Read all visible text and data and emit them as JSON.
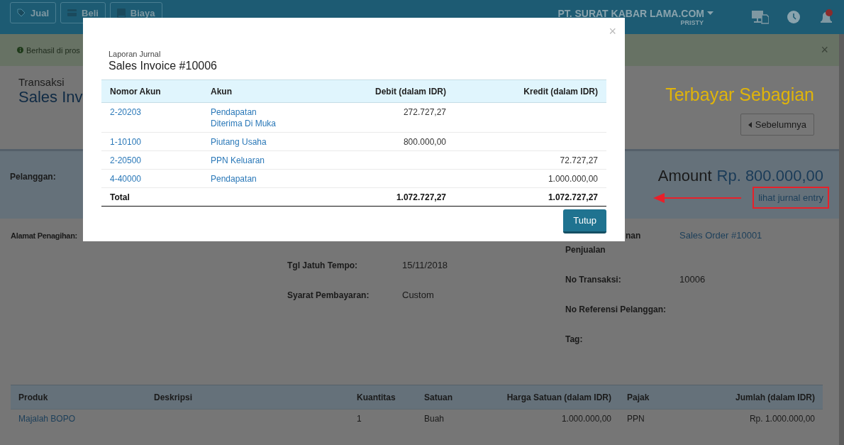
{
  "header": {
    "actions": [
      {
        "label": "Jual",
        "kind": "tag"
      },
      {
        "label": "Beli",
        "kind": "card"
      },
      {
        "label": "Biaya",
        "kind": "note"
      }
    ],
    "company": "PT. SURAT KABAR LAMA.COM",
    "user": "PRISTY",
    "notification_badge": true
  },
  "alert": {
    "text": "Berhasil di pros",
    "close": "×"
  },
  "page": {
    "subtitle": "Transaksi",
    "title": "Sales Inv",
    "status": "Terbayar Sebagian",
    "prev_button": "Sebelumnya"
  },
  "summary": {
    "customer_label": "Pelanggan:",
    "amount_label": "Amount",
    "amount_value": "Rp. 800.000,00",
    "journal_link": "lihat jurnal entry"
  },
  "details": [
    [
      {
        "label": "Alamat Penagihan:"
      }
    ],
    [
      {
        "label": "Tgl Jatuh Tempo:",
        "value": "15/11/2018"
      },
      {
        "label": "Syarat Pembayaran:",
        "value": "Custom"
      }
    ],
    [
      {
        "label": "nan Penjualan",
        "value": "Sales Order #10001",
        "kind": "link"
      },
      {
        "label": "No Transaksi:",
        "value": "10006",
        "kind": "text"
      },
      {
        "label": "No Referensi Pelanggan:"
      },
      {
        "label": "Tag:"
      }
    ]
  ],
  "products": {
    "columns": [
      "Produk",
      "Deskripsi",
      "Kuantitas",
      "Satuan",
      "Harga Satuan (dalam IDR)",
      "Pajak",
      "Jumlah (dalam IDR)"
    ],
    "rows": [
      {
        "product": "Majalah BOPO",
        "quantity": "1",
        "unit": "Buah",
        "price": "1.000.000,00",
        "tax": "PPN",
        "amount": "Rp. 1.000.000,00"
      }
    ]
  },
  "modal": {
    "close": "×",
    "subtitle": "Laporan Jurnal",
    "title": "Sales Invoice #10006",
    "columns": [
      "Nomor Akun",
      "Akun",
      "Debit (dalam IDR)",
      "Kredit (dalam IDR)"
    ],
    "rows": [
      {
        "account_no": "2-20203",
        "account": "Pendapatan Diterima Di Muka",
        "debit": "272.727,27"
      },
      {
        "account_no": "1-10100",
        "account": "Piutang Usaha",
        "debit": "800.000,00"
      },
      {
        "account_no": "2-20500",
        "account": "PPN Keluaran",
        "credit": "72.727,27"
      },
      {
        "account_no": "4-40000",
        "account": "Pendapatan",
        "credit": "1.000.000,00"
      }
    ],
    "total": {
      "label": "Total",
      "debit": "1.072.727,27",
      "credit": "1.072.727,27"
    },
    "button": "Tutup"
  }
}
